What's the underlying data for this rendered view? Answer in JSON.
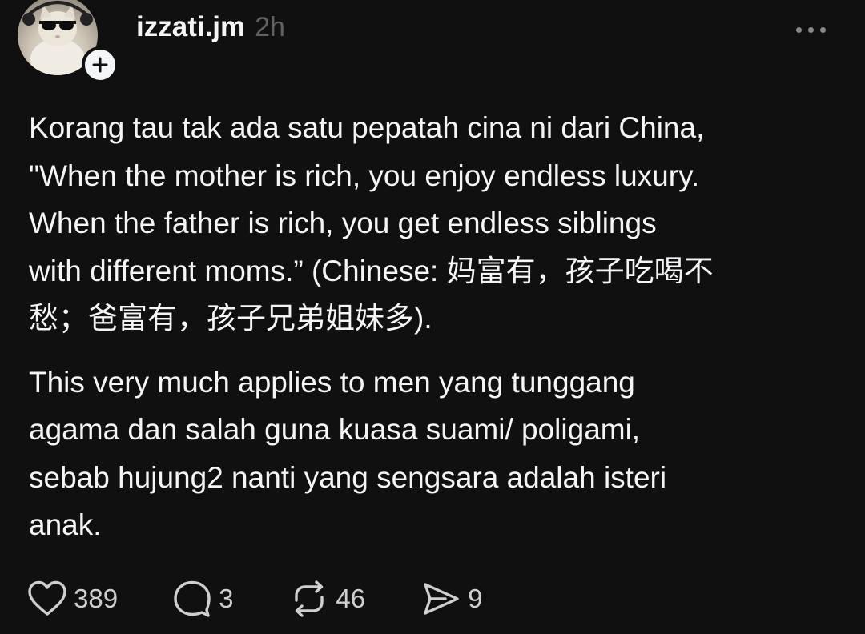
{
  "post": {
    "author": {
      "username": "izzati.jm",
      "avatar_icon": "cat-with-sunglasses-avatar",
      "follow_icon": "plus-icon"
    },
    "timestamp": "2h",
    "more_icon": "ellipsis-icon",
    "paragraphs": [
      "Korang tau tak ada satu pepatah cina ni dari China,\n\"When the mother is rich, you enjoy endless luxury.\nWhen the father is rich, you get endless siblings\nwith different moms.” (Chinese: 妈富有，孩子吃喝不\n愁；爸富有，孩子兄弟姐妹多).",
      "This very much applies to men yang tunggang\nagama dan salah guna kuasa suami/ poligami,\nsebab hujung2 nanti yang sengsara adalah isteri\nanak."
    ],
    "actions": {
      "like": {
        "count": "389",
        "icon": "heart-icon"
      },
      "reply": {
        "count": "3",
        "icon": "speech-bubble-icon"
      },
      "repost": {
        "count": "46",
        "icon": "repost-icon"
      },
      "share": {
        "count": "9",
        "icon": "send-icon"
      }
    }
  },
  "theme": {
    "background": "#101010",
    "text_primary": "#f3f5f7",
    "text_secondary": "#616161"
  }
}
